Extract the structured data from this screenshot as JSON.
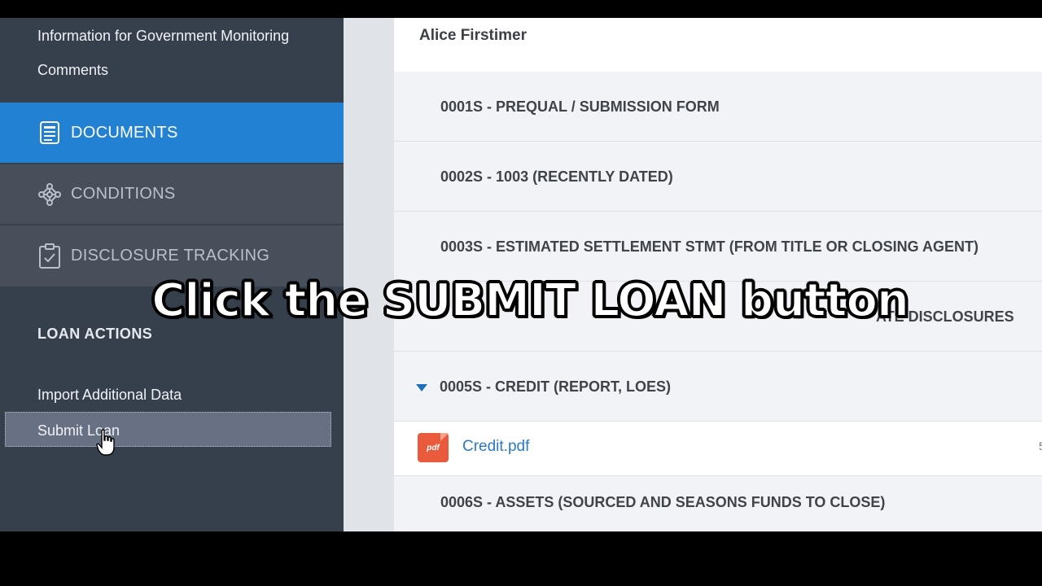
{
  "sidebar": {
    "links": [
      "Information for Government Monitoring",
      "Comments"
    ],
    "nav": {
      "documents": "DOCUMENTS",
      "conditions": "CONDITIONS",
      "disclosure_tracking": "DISCLOSURE TRACKING",
      "active": "documents"
    },
    "loan_actions": {
      "heading": "LOAN ACTIONS",
      "items": [
        "Import Additional Data",
        "Submit Loan"
      ],
      "hovered": "Submit Loan"
    }
  },
  "main": {
    "borrower": "Alice Firstimer",
    "documents": [
      "0001S - PREQUAL / SUBMISSION FORM",
      "0002S - 1003 (RECENTLY DATED)",
      "0003S - ESTIMATED SETTLEMENT STMT (FROM TITLE OR CLOSING AGENT)",
      "ATE DISCLOSURES",
      "0005S - CREDIT (REPORT, LOES)",
      "0006S - ASSETS (SOURCED AND SEASONS FUNDS TO CLOSE)"
    ],
    "expanded_index": 4,
    "file": {
      "icon": "pdf",
      "name": "Credit.pdf",
      "edge_text": "5"
    }
  },
  "caption": "Click the SUBMIT LOAN button",
  "colors": {
    "sidebar_bg": "#36404c",
    "active_nav": "#2281d3",
    "inactive_nav": "#474f5b",
    "link_blue": "#2a7ac6",
    "pdf_red": "#ea5a3d"
  }
}
